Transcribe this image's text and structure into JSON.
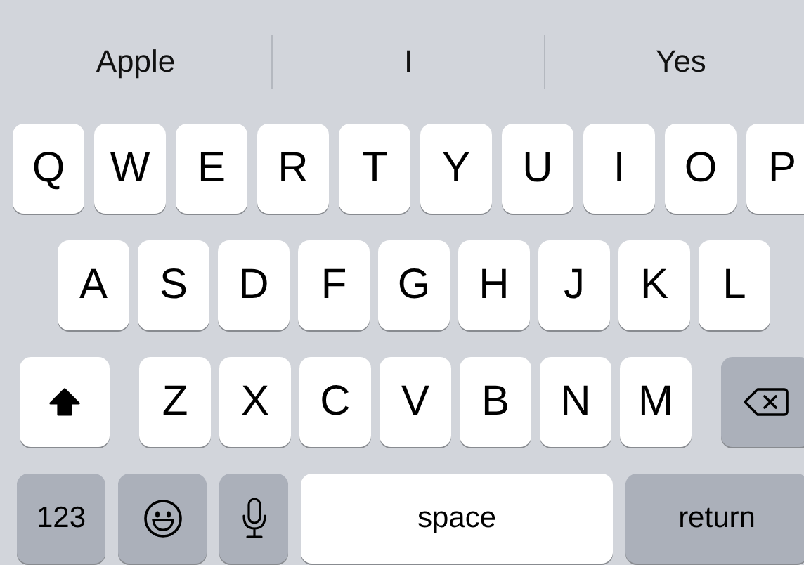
{
  "suggestions": [
    {
      "text": "Apple"
    },
    {
      "text": "I"
    },
    {
      "text": "Yes"
    }
  ],
  "rows": [
    [
      "Q",
      "W",
      "E",
      "R",
      "T",
      "Y",
      "U",
      "I",
      "O",
      "P"
    ],
    [
      "A",
      "S",
      "D",
      "F",
      "G",
      "H",
      "J",
      "K",
      "L"
    ],
    [
      "Z",
      "X",
      "C",
      "V",
      "B",
      "N",
      "M"
    ]
  ],
  "shift": {
    "on": true
  },
  "bottom": {
    "numbers": "123",
    "space": "space",
    "return": "return"
  }
}
